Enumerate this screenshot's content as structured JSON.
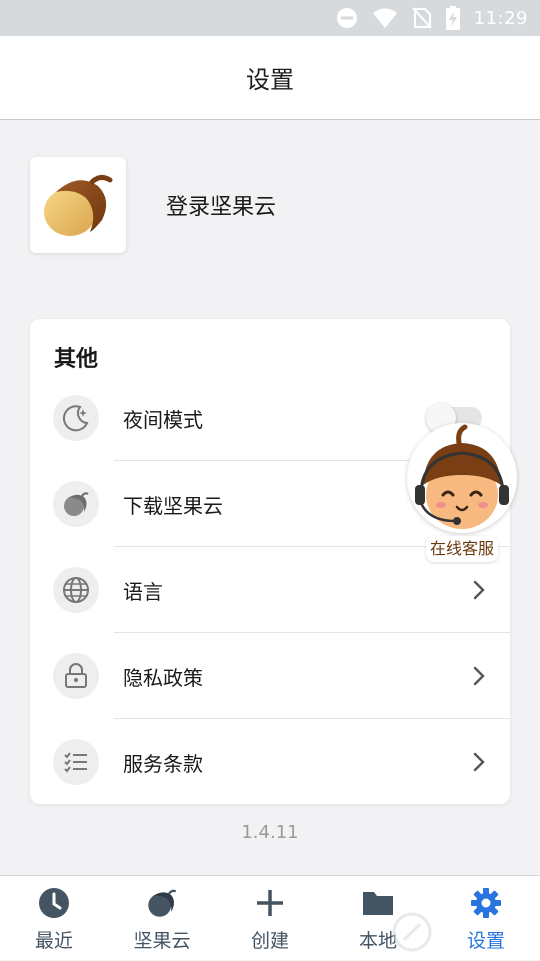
{
  "status_bar": {
    "time": "11:29",
    "icons": [
      "dnd-icon",
      "wifi-icon",
      "no-sim-icon",
      "battery-charging-icon"
    ]
  },
  "app_bar": {
    "title": "设置"
  },
  "account": {
    "login_label": "登录坚果云",
    "logo_icon": "nut-logo-icon"
  },
  "other_section": {
    "title": "其他",
    "items": [
      {
        "label": "夜间模式",
        "icon": "moon-icon",
        "control": "toggle",
        "toggle_on": false
      },
      {
        "label": "下载坚果云",
        "icon": "nut-icon",
        "control": "none"
      },
      {
        "label": "语言",
        "icon": "globe-icon",
        "control": "chevron"
      },
      {
        "label": "隐私政策",
        "icon": "lock-icon",
        "control": "chevron"
      },
      {
        "label": "服务条款",
        "icon": "checklist-icon",
        "control": "chevron"
      }
    ]
  },
  "version": "1.4.11",
  "customer_service": {
    "label": "在线客服",
    "icon": "mascot-headset-icon"
  },
  "tab_bar": {
    "tabs": [
      {
        "label": "最近",
        "icon": "clock-icon",
        "active": false
      },
      {
        "label": "坚果云",
        "icon": "nut-icon",
        "active": false
      },
      {
        "label": "创建",
        "icon": "plus-icon",
        "active": false
      },
      {
        "label": "本地",
        "icon": "folder-icon",
        "active": false
      },
      {
        "label": "设置",
        "icon": "gear-icon",
        "active": true
      }
    ]
  },
  "colors": {
    "accent": "#2a74e0",
    "tab_inactive": "#455463",
    "status_bar": "#d6dadd",
    "mascot_brown": "#7a3e14"
  }
}
